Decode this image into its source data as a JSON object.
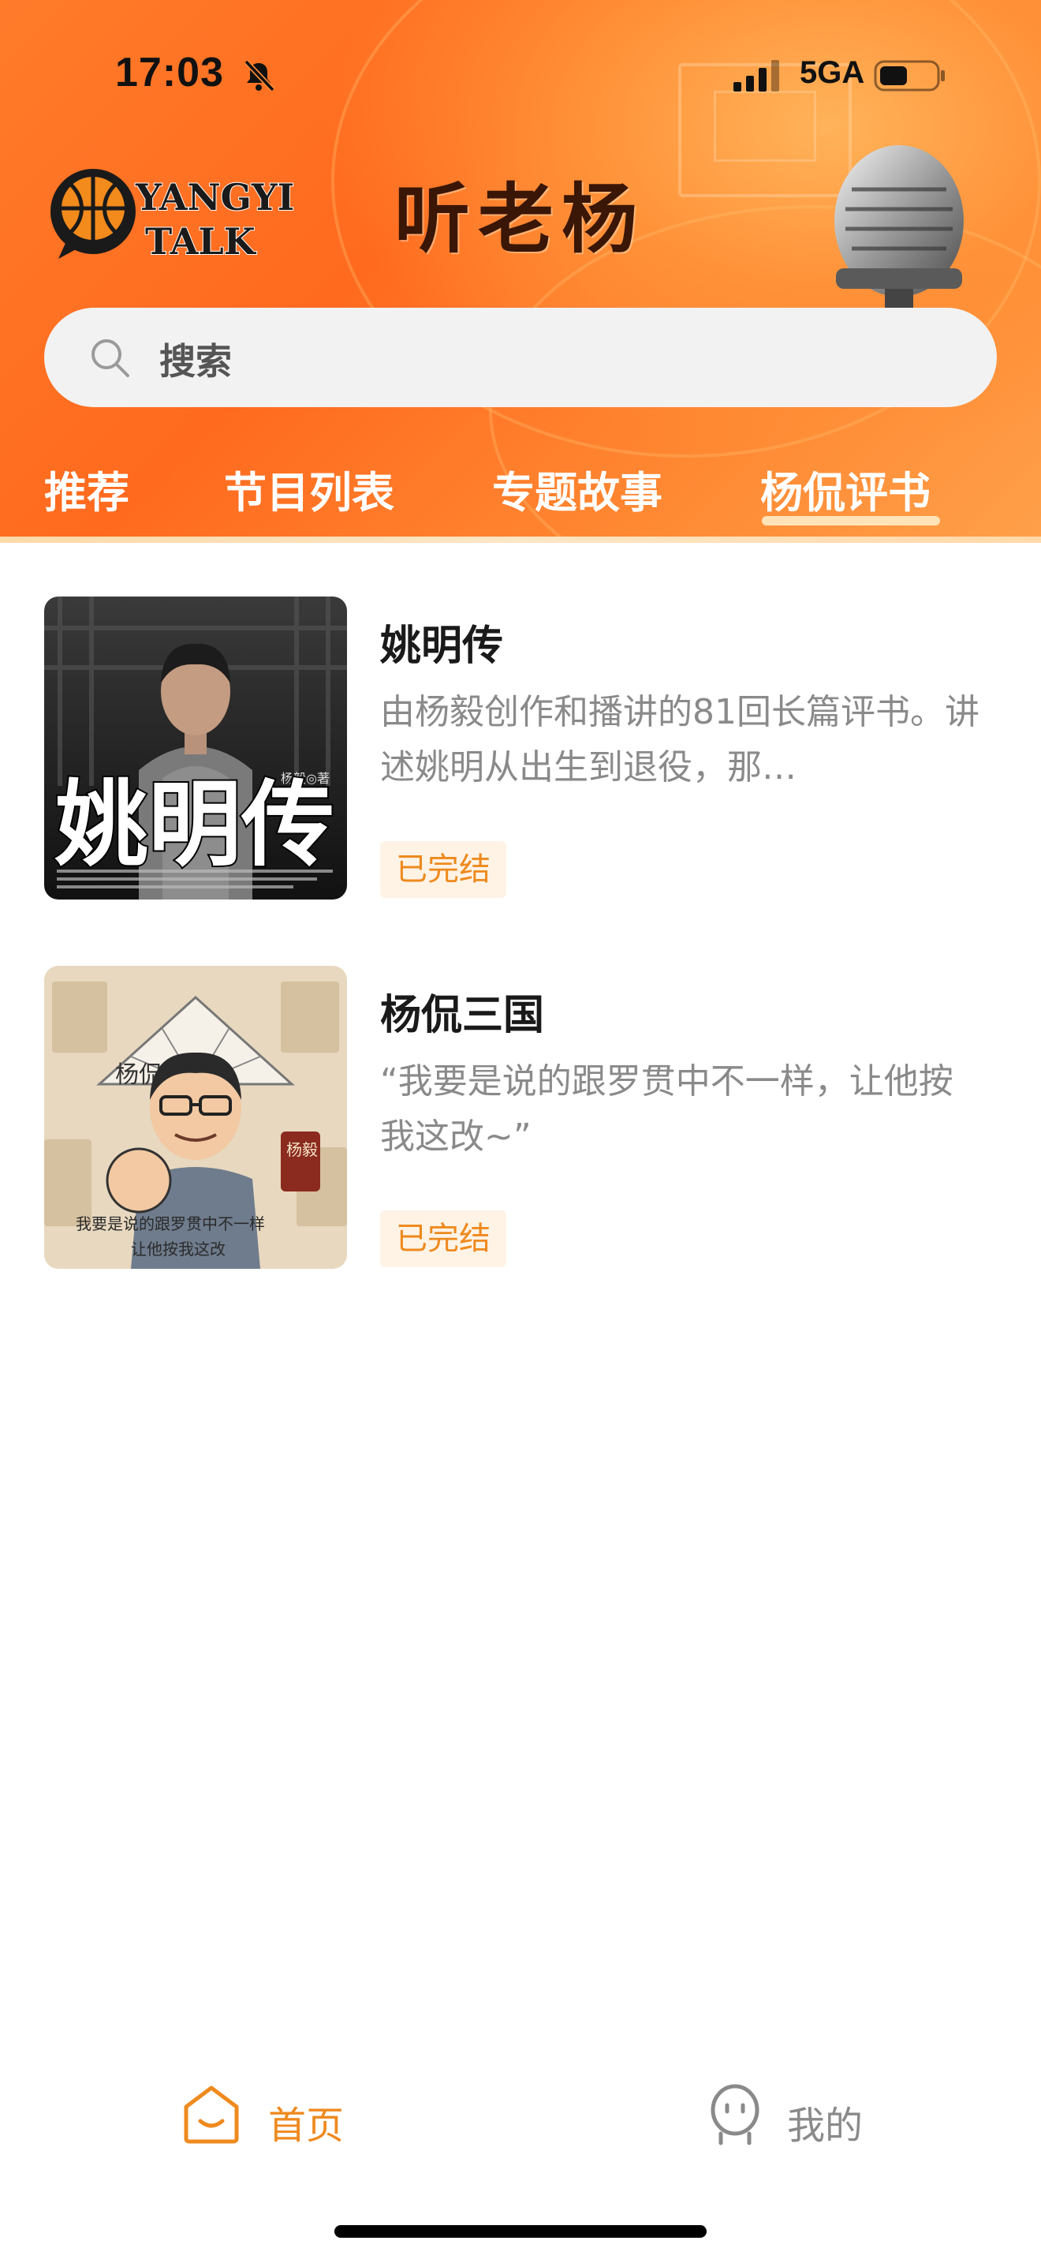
{
  "status_bar": {
    "time": "17:03",
    "network": "5GA"
  },
  "header": {
    "logo_text_top": "YANGYI",
    "logo_text_bottom": "TALK",
    "title": "听老杨"
  },
  "search": {
    "placeholder": "搜索"
  },
  "tabs": [
    {
      "label": "推荐"
    },
    {
      "label": "节目列表"
    },
    {
      "label": "专题故事"
    },
    {
      "label": "杨侃评书",
      "active": true
    }
  ],
  "items": [
    {
      "title": "姚明传",
      "description": "由杨毅创作和播讲的81回长篇评书。讲述姚明从出生到退役，那…",
      "status": "已完结",
      "cover": {
        "big_text": "姚明传",
        "author": "杨毅◎著"
      }
    },
    {
      "title": "杨侃三国",
      "description": "“我要是说的跟罗贯中不一样，让他按我这改~”",
      "status": "已完结",
      "cover": {
        "fan_text": "杨侃三国",
        "seal": "杨毅",
        "caption_line1": "我要是说的跟罗贯中不一样",
        "caption_line2": "让他按我这改"
      }
    }
  ],
  "bottom_nav": [
    {
      "label": "首页",
      "icon": "home-icon",
      "active": true
    },
    {
      "label": "我的",
      "icon": "profile-icon",
      "active": false
    }
  ],
  "colors": {
    "accent": "#ee8a1e",
    "header_orange": "#ff7b2a",
    "inactive": "#8a8a8a"
  }
}
